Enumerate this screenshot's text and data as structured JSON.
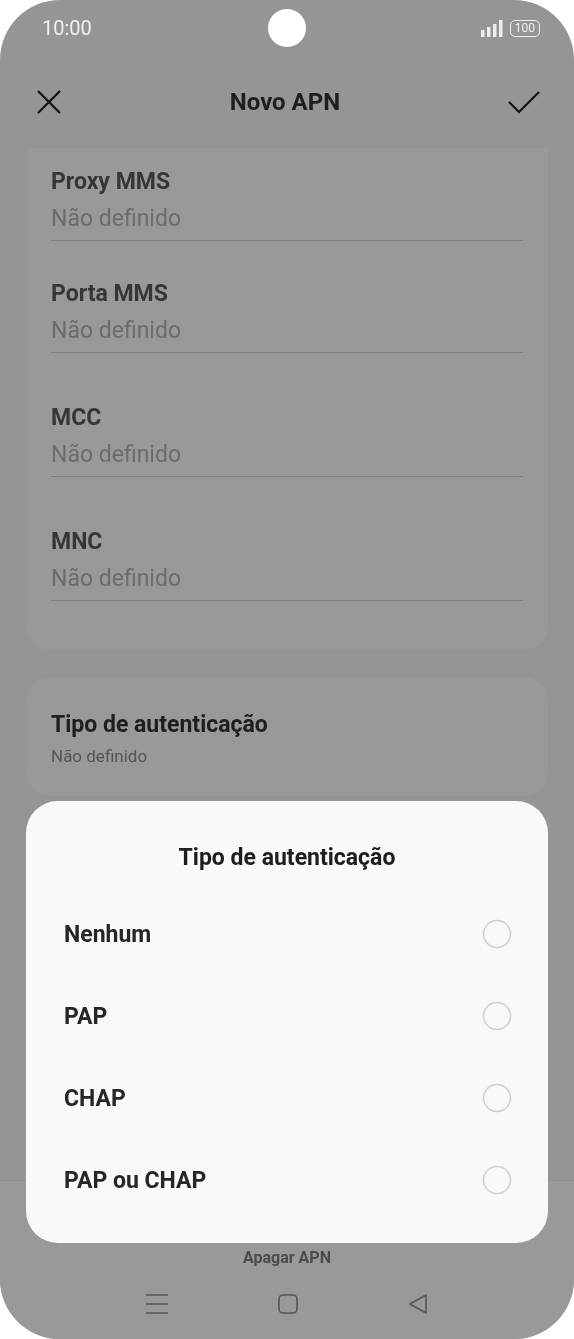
{
  "status_bar": {
    "time": "10:00",
    "battery": "100"
  },
  "header": {
    "title": "Novo APN"
  },
  "fields": [
    {
      "label": "Proxy MMS",
      "value": "Não definido"
    },
    {
      "label": "Porta MMS",
      "value": "Não definido"
    },
    {
      "label": "MCC",
      "value": "Não definido"
    },
    {
      "label": "MNC",
      "value": "Não definido"
    }
  ],
  "auth_setting": {
    "label": "Tipo de autenticação",
    "value": "Não definido"
  },
  "delete_button": "Apagar APN",
  "dialog": {
    "title": "Tipo de autenticação",
    "options": [
      {
        "label": "Nenhum",
        "selected": false
      },
      {
        "label": "PAP",
        "selected": false
      },
      {
        "label": "CHAP",
        "selected": false
      },
      {
        "label": "PAP ou CHAP",
        "selected": false
      }
    ]
  }
}
